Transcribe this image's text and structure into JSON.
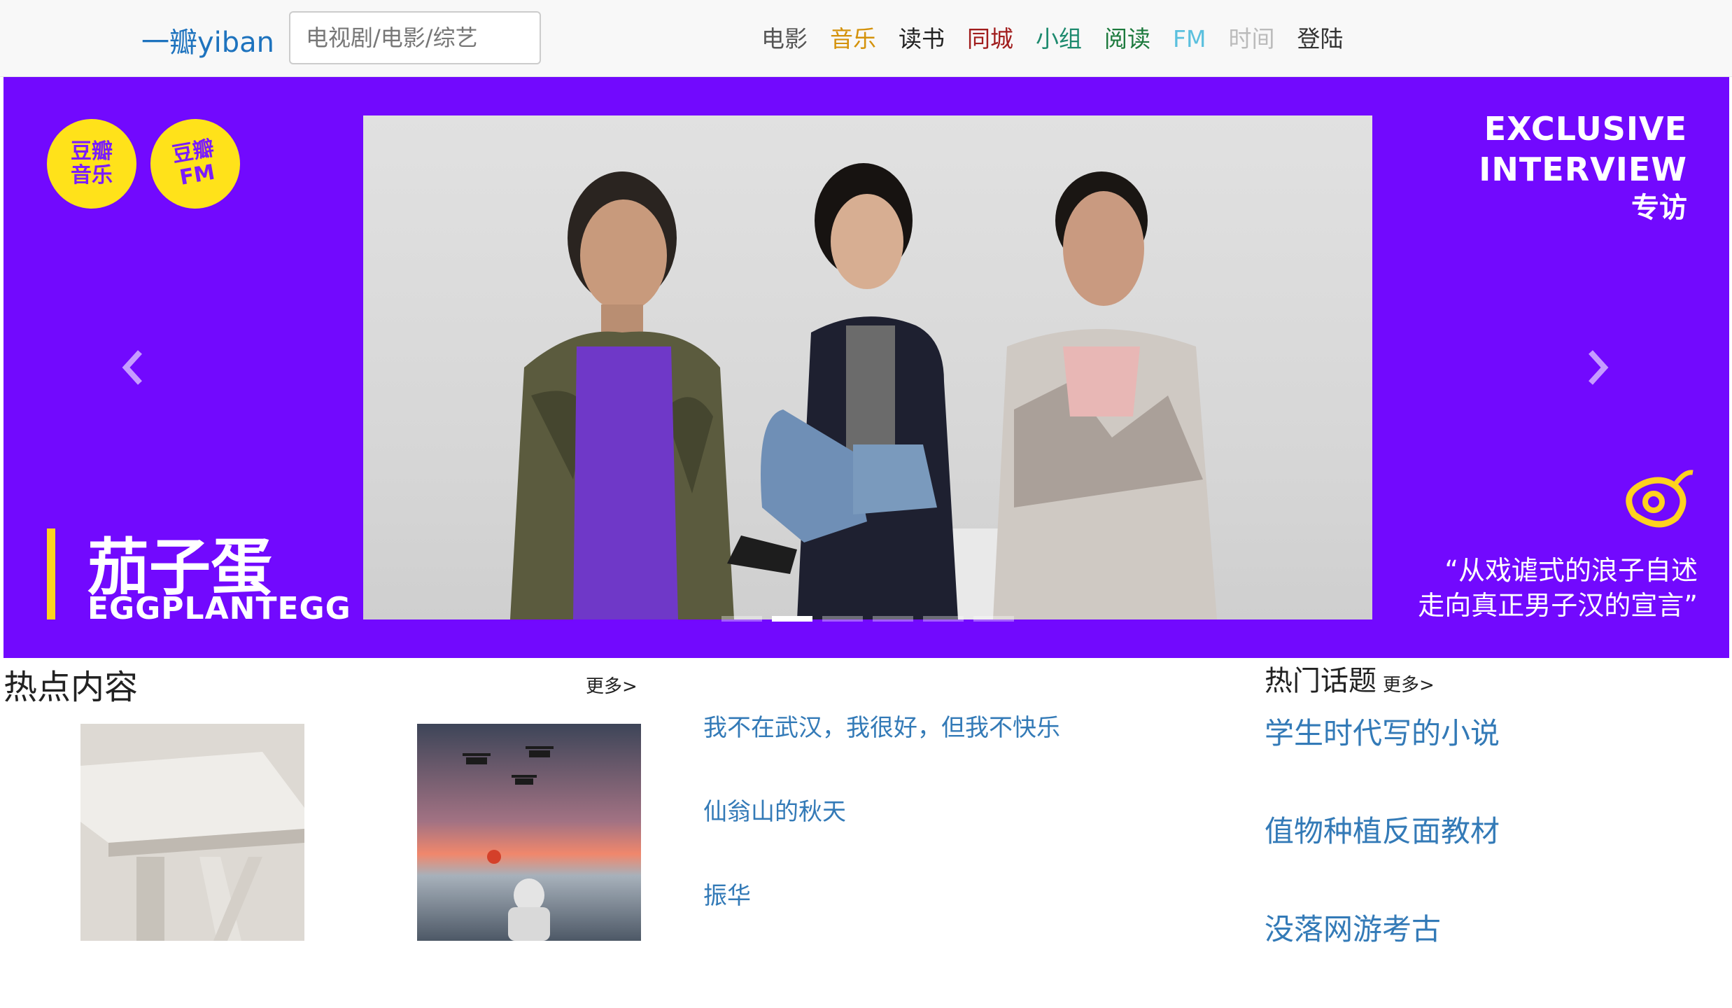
{
  "navbar": {
    "brand": "一瓣yiban",
    "search_placeholder": "电视剧/电影/综艺",
    "links": [
      {
        "label": "电影",
        "color": "#555555"
      },
      {
        "label": "音乐",
        "color": "#d4920b"
      },
      {
        "label": "读书",
        "color": "#222222"
      },
      {
        "label": "同城",
        "color": "#a11d1d"
      },
      {
        "label": "小组",
        "color": "#1d8a6e"
      },
      {
        "label": "阅读",
        "color": "#1d7a3d"
      },
      {
        "label": "FM",
        "color": "#5bc0de"
      },
      {
        "label": "时间",
        "color": "#bbbbbb"
      },
      {
        "label": "登陆",
        "color": "#333333"
      }
    ]
  },
  "carousel": {
    "background": "#7209fe",
    "badges": [
      "豆瓣\n音乐",
      "豆瓣\nFM"
    ],
    "exclusive_en_1": "EXCLUSIVE",
    "exclusive_en_2": "INTERVIEW",
    "exclusive_zh": "专访",
    "band_zh": "茄子蛋",
    "band_en": "EGGPLANTEGG",
    "quote_1": "“从戏谑式的浪子自述",
    "quote_2": "走向真正男子汉的宣言”",
    "prev_icon": "chevron-left-icon",
    "next_icon": "chevron-right-icon",
    "slide_count": 6,
    "active_slide": 2
  },
  "hot": {
    "title": "热点内容",
    "more": "更多>",
    "items": [
      "我不在武汉，我很好，但我不快乐",
      "仙翁山的秋天",
      "振华"
    ]
  },
  "topics": {
    "title": "热门话题",
    "more": "更多>",
    "items": [
      "学生时代写的小说",
      "值物种植反面教材",
      "没落网游考古"
    ]
  }
}
